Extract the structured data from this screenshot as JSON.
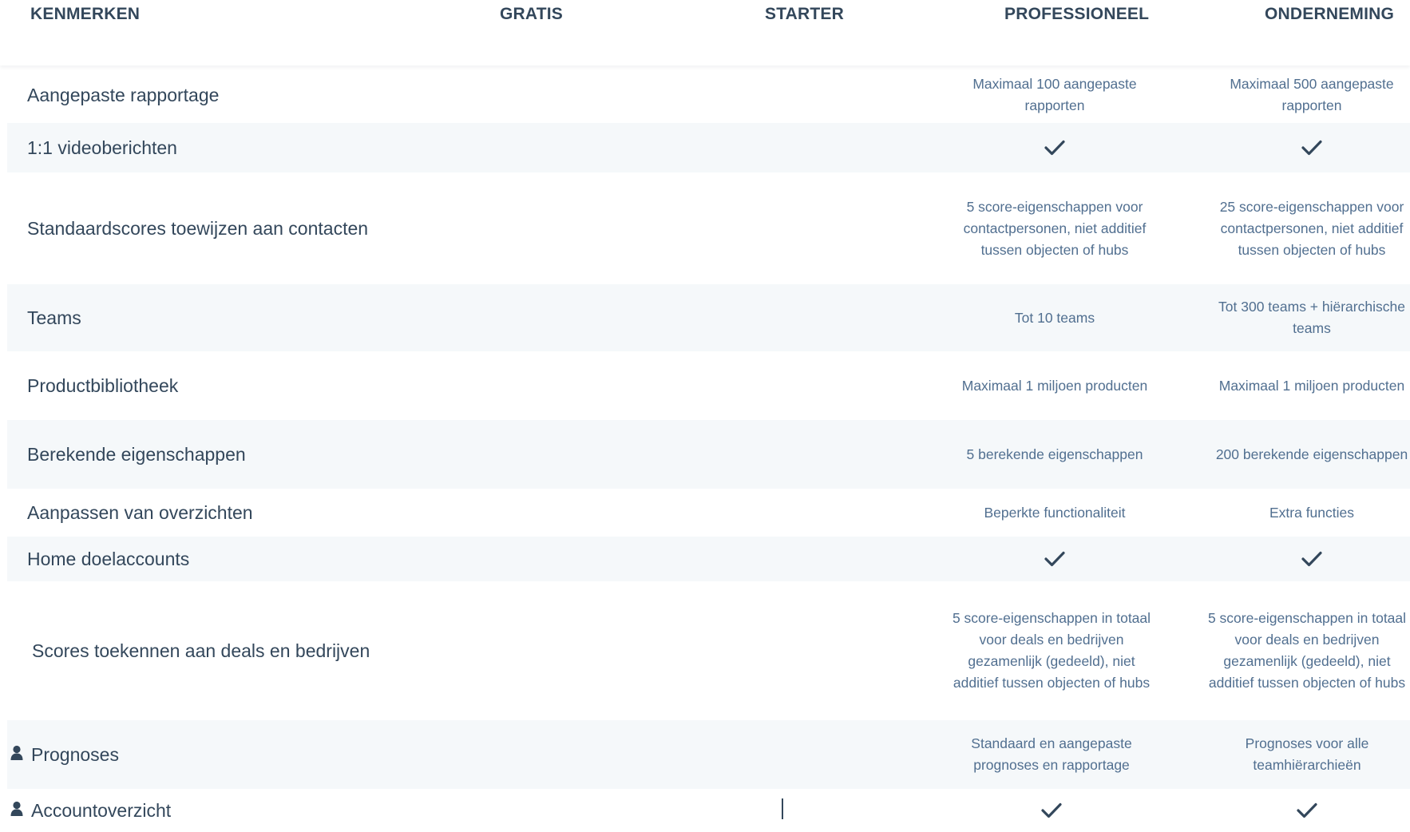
{
  "header": {
    "features": "KENMERKEN",
    "free": "GRATIS",
    "starter": "STARTER",
    "professional": "PROFESSIONEEL",
    "enterprise": "ONDERNEMING"
  },
  "rows": [
    {
      "feature": "Aangepaste rapportage",
      "pro": "Maximaal 100 aangepaste rapporten",
      "ent": "Maximaal 500 aangepaste rapporten"
    },
    {
      "feature": "1:1 videoberichten",
      "pro": "check-icon",
      "ent": "check-icon"
    },
    {
      "feature": "Standaardscores toewijzen aan contacten",
      "pro": "5 score-eigenschappen voor contactpersonen, niet additief tussen objecten of hubs",
      "ent": "25 score-eigenschappen voor contactpersonen, niet additief tussen objecten of hubs"
    },
    {
      "feature": "Teams",
      "pro": "Tot 10 teams",
      "ent": "Tot 300 teams + hiërarchische teams"
    },
    {
      "feature": "Productbibliotheek",
      "pro": "Maximaal 1 miljoen producten",
      "ent": "Maximaal 1 miljoen producten"
    },
    {
      "feature": "Berekende eigenschappen",
      "pro": "5 berekende eigenschappen",
      "ent": "200 berekende eigenschappen"
    },
    {
      "feature": "Aanpassen van overzichten",
      "pro": "Beperkte functionaliteit",
      "ent": "Extra functies"
    },
    {
      "feature": "Home doelaccounts",
      "pro": "check-icon",
      "ent": "check-icon"
    },
    {
      "feature": "Scores toekennen aan deals en bedrijven",
      "pro": "5 score-eigenschappen in totaal voor deals en bedrijven gezamenlijk (gedeeld), niet additief tussen objecten of hubs",
      "ent": "5 score-eigenschappen in totaal voor deals en bedrijven gezamenlijk (gedeeld), niet additief tussen objecten of hubs"
    },
    {
      "feature": "Prognoses",
      "icon": "person-icon",
      "pro": "Standaard en aangepaste prognoses en rapportage",
      "ent": "Prognoses voor alle teamhiërarchieën"
    },
    {
      "feature": "Accountoverzicht",
      "icon": "person-icon",
      "pro": "check-icon",
      "ent": "check-icon"
    }
  ],
  "colors": {
    "text": "#33475b",
    "muted": "#516f90",
    "stripe": "#f5f8fa"
  }
}
